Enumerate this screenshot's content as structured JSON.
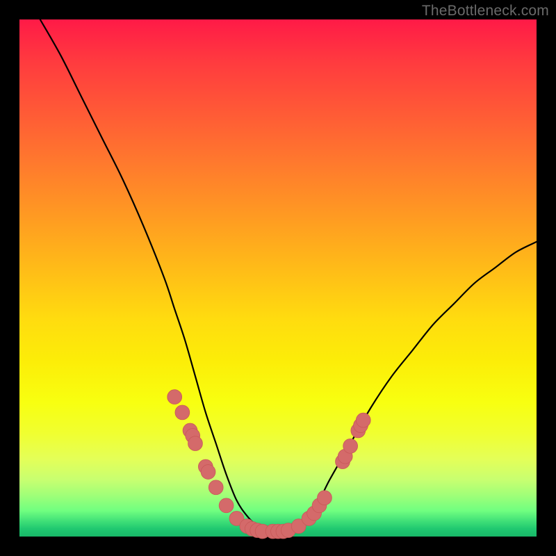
{
  "watermark": "TheBottleneck.com",
  "colors": {
    "frame": "#000000",
    "curve": "#000000",
    "marker_fill": "#d46a6a",
    "marker_stroke": "#c85858"
  },
  "chart_data": {
    "type": "line",
    "title": "",
    "xlabel": "",
    "ylabel": "",
    "xlim": [
      0,
      100
    ],
    "ylim": [
      0,
      100
    ],
    "grid": false,
    "legend": false,
    "series": [
      {
        "name": "bottleneck-curve",
        "x": [
          4,
          8,
          12,
          16,
          20,
          24,
          28,
          30,
          32,
          34,
          36,
          38,
          40,
          42,
          44,
          46,
          48,
          50,
          52,
          54,
          56,
          58,
          60,
          64,
          68,
          72,
          76,
          80,
          84,
          88,
          92,
          96,
          100
        ],
        "y": [
          100,
          93,
          85,
          77,
          69,
          60,
          50,
          44,
          38,
          31,
          24,
          18,
          12,
          7,
          4,
          2,
          1,
          1,
          1,
          2,
          4,
          7,
          11,
          18,
          25,
          31,
          36,
          41,
          45,
          49,
          52,
          55,
          57
        ]
      }
    ],
    "markers": [
      {
        "x": 30.0,
        "y": 27.0
      },
      {
        "x": 31.5,
        "y": 24.0
      },
      {
        "x": 33.0,
        "y": 20.5
      },
      {
        "x": 33.5,
        "y": 19.5
      },
      {
        "x": 34.0,
        "y": 18.0
      },
      {
        "x": 36.0,
        "y": 13.5
      },
      {
        "x": 36.5,
        "y": 12.5
      },
      {
        "x": 38.0,
        "y": 9.5
      },
      {
        "x": 40.0,
        "y": 6.0
      },
      {
        "x": 42.0,
        "y": 3.5
      },
      {
        "x": 44.0,
        "y": 2.0
      },
      {
        "x": 45.0,
        "y": 1.5
      },
      {
        "x": 46.0,
        "y": 1.2
      },
      {
        "x": 47.0,
        "y": 1.0
      },
      {
        "x": 49.0,
        "y": 1.0
      },
      {
        "x": 50.0,
        "y": 1.0
      },
      {
        "x": 51.0,
        "y": 1.0
      },
      {
        "x": 52.0,
        "y": 1.2
      },
      {
        "x": 54.0,
        "y": 2.0
      },
      {
        "x": 56.0,
        "y": 3.5
      },
      {
        "x": 57.0,
        "y": 4.5
      },
      {
        "x": 58.0,
        "y": 6.0
      },
      {
        "x": 59.0,
        "y": 7.5
      },
      {
        "x": 62.5,
        "y": 14.5
      },
      {
        "x": 63.0,
        "y": 15.5
      },
      {
        "x": 64.0,
        "y": 17.5
      },
      {
        "x": 65.5,
        "y": 20.5
      },
      {
        "x": 66.0,
        "y": 21.5
      },
      {
        "x": 66.5,
        "y": 22.5
      }
    ],
    "marker_radius": 1.4
  }
}
